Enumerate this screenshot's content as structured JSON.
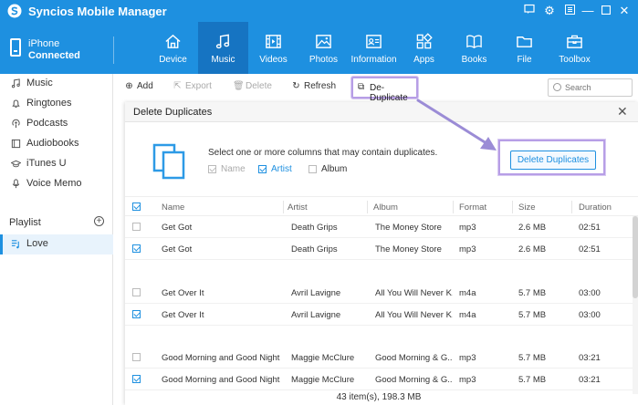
{
  "app": {
    "title": "Syncios Mobile Manager"
  },
  "device": {
    "name": "iPhone",
    "status": "Connected"
  },
  "nav": [
    {
      "label": "Device",
      "icon": "home-icon"
    },
    {
      "label": "Music",
      "icon": "music-note-icon"
    },
    {
      "label": "Videos",
      "icon": "film-icon"
    },
    {
      "label": "Photos",
      "icon": "image-icon"
    },
    {
      "label": "Information",
      "icon": "contact-card-icon"
    },
    {
      "label": "Apps",
      "icon": "apps-grid-icon"
    },
    {
      "label": "Books",
      "icon": "book-icon"
    },
    {
      "label": "File",
      "icon": "folder-icon"
    },
    {
      "label": "Toolbox",
      "icon": "toolbox-icon"
    }
  ],
  "nav_active": "Music",
  "sidebar": {
    "items": [
      {
        "label": "Music",
        "icon": "music-note-icon"
      },
      {
        "label": "Ringtones",
        "icon": "bell-icon"
      },
      {
        "label": "Podcasts",
        "icon": "podcast-icon"
      },
      {
        "label": "Audiobooks",
        "icon": "book-icon"
      },
      {
        "label": "iTunes U",
        "icon": "graduation-cap-icon"
      },
      {
        "label": "Voice Memo",
        "icon": "microphone-icon"
      }
    ],
    "playlist_heading": "Playlist",
    "playlists": [
      {
        "label": "Love",
        "icon": "playlist-icon"
      }
    ]
  },
  "toolbar": {
    "add": "Add",
    "export": "Export",
    "delete": "Delete",
    "refresh": "Refresh",
    "dedup": "De-Duplicate",
    "search_placeholder": "Search"
  },
  "dialog": {
    "title": "Delete Duplicates",
    "description": "Select one or more columns that may contain duplicates.",
    "options": [
      {
        "label": "Name",
        "checked": true,
        "disabled": true
      },
      {
        "label": "Artist",
        "checked": true,
        "disabled": false
      },
      {
        "label": "Album",
        "checked": false,
        "disabled": false
      }
    ],
    "delete_button": "Delete Duplicates",
    "columns": [
      "Name",
      "Artist",
      "Album",
      "Format",
      "Size",
      "Duration"
    ],
    "rows": [
      {
        "checked": false,
        "name": "Get Got",
        "artist": "Death Grips",
        "album": "The Money Store",
        "format": "mp3",
        "size": "2.6 MB",
        "duration": "02:51"
      },
      {
        "checked": true,
        "name": "Get Got",
        "artist": "Death Grips",
        "album": "The Money Store",
        "format": "mp3",
        "size": "2.6 MB",
        "duration": "02:51"
      },
      {
        "checked": false,
        "name": "Get Over It",
        "artist": "Avril Lavigne",
        "album": "All You Will Never K...",
        "format": "m4a",
        "size": "5.7 MB",
        "duration": "03:00"
      },
      {
        "checked": true,
        "name": "Get Over It",
        "artist": "Avril Lavigne",
        "album": "All You Will Never K...",
        "format": "m4a",
        "size": "5.7 MB",
        "duration": "03:00"
      },
      {
        "checked": false,
        "name": "Good Morning and Good Night",
        "artist": "Maggie McClure",
        "album": "Good Morning & G...",
        "format": "mp3",
        "size": "5.7 MB",
        "duration": "03:21"
      },
      {
        "checked": true,
        "name": "Good Morning and Good Night",
        "artist": "Maggie McClure",
        "album": "Good Morning & G...",
        "format": "mp3",
        "size": "5.7 MB",
        "duration": "03:21"
      }
    ],
    "footer": "43 item(s), 198.3 MB"
  },
  "colors": {
    "brand": "#1e90e0",
    "nav_active": "#1674c2",
    "highlight": "#b79ee6"
  }
}
